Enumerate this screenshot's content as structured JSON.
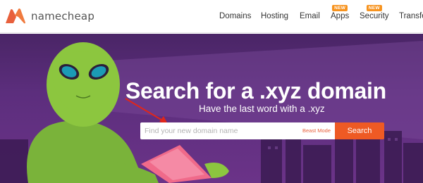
{
  "brand": {
    "name": "namecheap",
    "logo_icon": "namecheap-logo-icon",
    "logo_color": "#e8603c"
  },
  "nav": {
    "items": [
      {
        "label": "Domains"
      },
      {
        "label": "Hosting"
      },
      {
        "label": "Email"
      },
      {
        "label": "Apps",
        "badge": "NEW"
      },
      {
        "label": "Security",
        "badge": "NEW"
      },
      {
        "label": "Transfer"
      }
    ]
  },
  "hero": {
    "headline": "Search for a .xyz domain",
    "subline": "Have the last word with a .xyz",
    "search": {
      "placeholder": "Find your new domain name",
      "beast_mode_label": "Beast Mode",
      "button_label": "Search"
    },
    "colors": {
      "background": "#5c2e7d",
      "accent": "#ee5a24",
      "alien": "#8cc63f",
      "laptop": "#f06a8a"
    }
  }
}
